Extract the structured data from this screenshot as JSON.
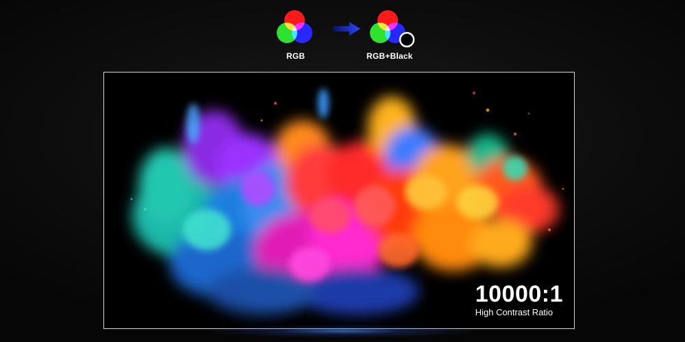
{
  "diagram": {
    "left_label": "RGB",
    "right_label": "RGB+Black",
    "arrow_icon": "right-arrow-icon",
    "colors": {
      "red": "#ff1a1a",
      "green": "#22e022",
      "blue": "#1a1aff",
      "black": "#000000",
      "arrow": "#1f3cff"
    }
  },
  "display": {
    "image_icon": "color-powder-explosion-image",
    "contrast_value": "10000:1",
    "contrast_caption": "High Contrast Ratio"
  }
}
